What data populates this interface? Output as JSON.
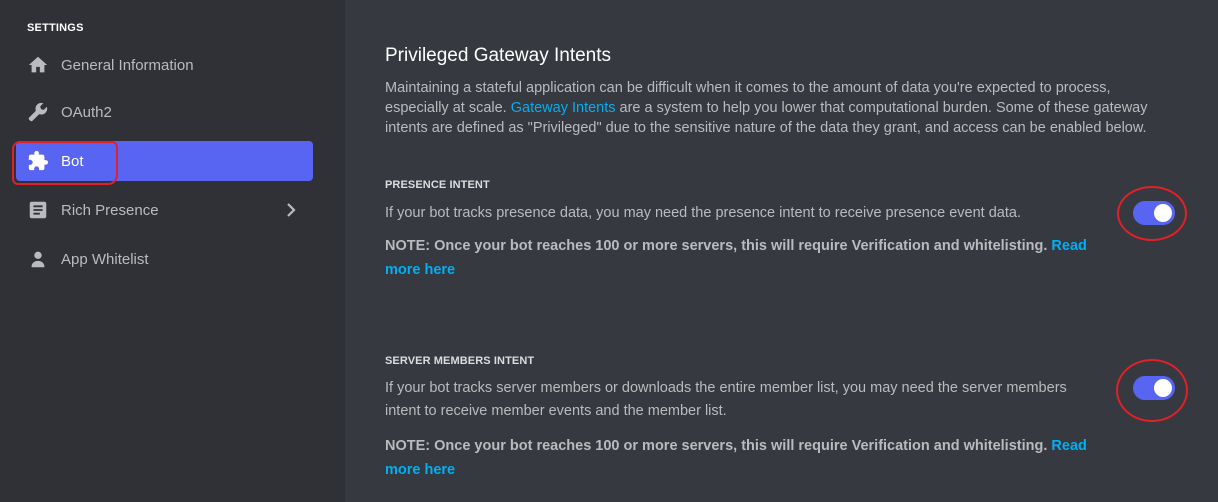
{
  "sidebar": {
    "heading": "SETTINGS",
    "items": [
      {
        "label": "General Information",
        "icon": "home-icon"
      },
      {
        "label": "OAuth2",
        "icon": "wrench-icon"
      },
      {
        "label": "Bot",
        "icon": "puzzle-icon",
        "active": true
      },
      {
        "label": "Rich Presence",
        "icon": "document-icon",
        "has_chevron": true
      },
      {
        "label": "App Whitelist",
        "icon": "person-icon"
      }
    ]
  },
  "main": {
    "title": "Privileged Gateway Intents",
    "description": {
      "part1": "Maintaining a stateful application can be difficult when it comes to the amount of data you're expected to process, especially at scale. ",
      "link": "Gateway Intents",
      "part2": " are a system to help you lower that computational burden. Some of these gateway intents are defined as \"Privileged\" due to the sensitive nature of the data they grant, and access can be enabled below."
    },
    "presence": {
      "label": "PRESENCE INTENT",
      "text": "If your bot tracks presence data, you may need the presence intent to receive presence event data.",
      "note": "NOTE: Once your bot reaches 100 or more servers, this will require Verification and whitelisting. ",
      "note_link": "Read more here",
      "enabled": true
    },
    "server_members": {
      "label": "SERVER MEMBERS INTENT",
      "text": "If your bot tracks server members or downloads the entire member list, you may need the server members intent to receive member events and the member list.",
      "note": "NOTE: Once your bot reaches 100 or more servers, this will require Verification and whitelisting. ",
      "note_link": "Read more here",
      "enabled": true
    }
  },
  "colors": {
    "accent": "#5865f2",
    "link": "#00aff4",
    "annotation": "#e0202a"
  }
}
